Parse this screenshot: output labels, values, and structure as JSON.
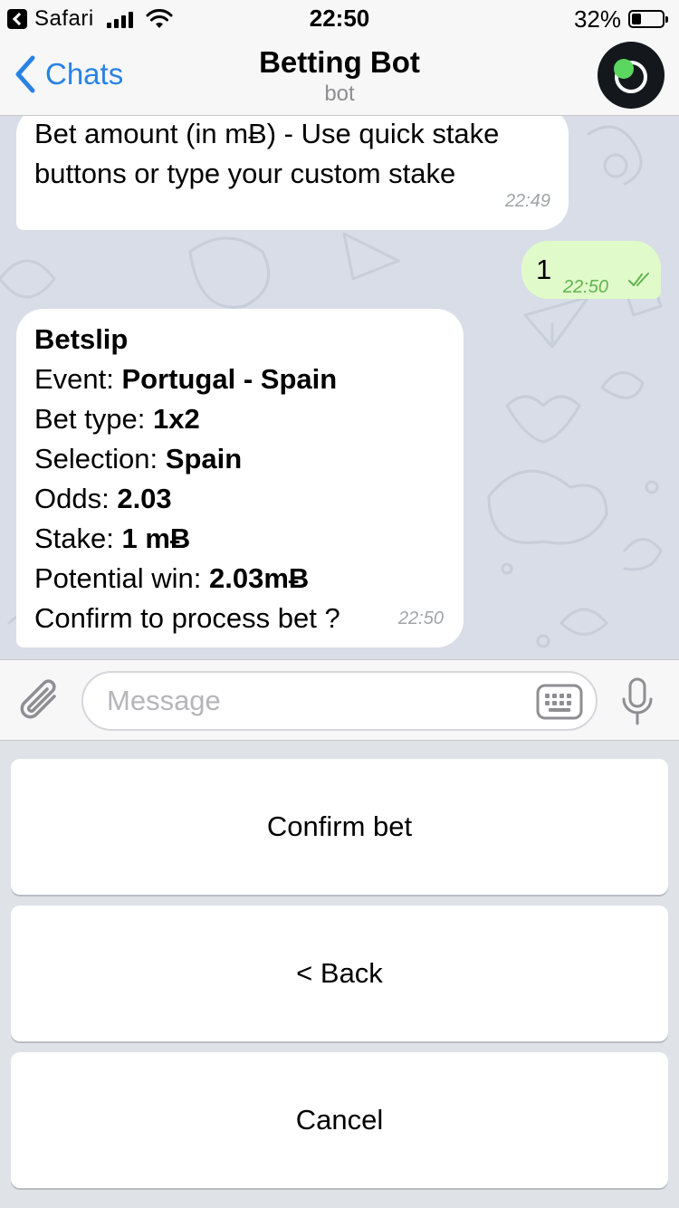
{
  "status_bar": {
    "back_app": "Safari",
    "time": "22:50",
    "battery_percent_label": "32%",
    "battery_level": 0.32
  },
  "nav": {
    "back_label": "Chats",
    "title": "Betting Bot",
    "subtitle": "bot",
    "avatar_accent": "#5bd65f"
  },
  "messages": [
    {
      "direction": "incoming",
      "text_lines": [
        "Bet amount (in mɃ) - Use quick stake",
        "buttons or type your custom stake"
      ],
      "time": "22:49"
    },
    {
      "direction": "outgoing",
      "text": "1",
      "time": "22:50",
      "status": "read-double-check"
    },
    {
      "direction": "incoming",
      "heading": "Betslip",
      "rows": [
        {
          "label": "Event: ",
          "value": "Portugal - Spain"
        },
        {
          "label": "Bet type: ",
          "value": "1x2"
        },
        {
          "label": "Selection: ",
          "value": "Spain"
        },
        {
          "label": "Odds: ",
          "value": "2.03"
        },
        {
          "label": "Stake: ",
          "value": "1 mɃ"
        },
        {
          "label": "Potential win: ",
          "value": "2.03mɃ"
        }
      ],
      "footer": "Confirm to process bet ?",
      "time": "22:50"
    }
  ],
  "composer": {
    "placeholder": "Message",
    "value": ""
  },
  "reply_keyboard": {
    "buttons": [
      "Confirm bet",
      "< Back",
      "Cancel"
    ]
  },
  "icons": {
    "attach": "paperclip-icon",
    "keyboard": "keyboard-icon",
    "mic": "microphone-icon",
    "back": "chevron-left-icon"
  },
  "colors": {
    "accent": "#2a82e4",
    "outgoing_bubble": "#e0fbc9",
    "outgoing_time": "#5fb44f",
    "chat_background": "#d8dde7"
  }
}
